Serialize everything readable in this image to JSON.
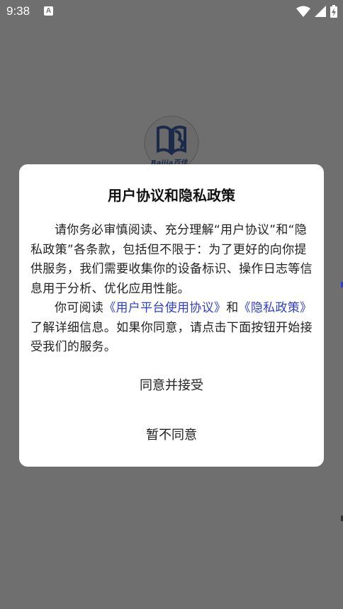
{
  "status_bar": {
    "time": "9:38",
    "notification_icon": "a-letter-icon",
    "wifi_icon": "wifi-icon",
    "signal_icon": "signal-icon",
    "battery_icon": "battery-charging-icon"
  },
  "background": {
    "logo_text": "Baijia百佳"
  },
  "dialog": {
    "title": "用户协议和隐私政策",
    "paragraph1": "请你务必审慎阅读、充分理解“用户协议”和“隐私政策”各条款，包括但不限于：为了更好的向你提供服务，我们需要收集你的设备标识、操作日志等信息用于分析、优化应用性能。",
    "paragraph2_prefix": "你可阅读",
    "user_agreement_link": "《用户平台使用协议》",
    "paragraph2_and": "和",
    "privacy_link": "《隐私政策》",
    "paragraph2_suffix": "了解详细信息。如果你同意，请点击下面按钮开始接受我们的服务。",
    "agree_button": "同意并接受",
    "decline_button": "暂不同意",
    "link_color": "#2f3fd0"
  }
}
